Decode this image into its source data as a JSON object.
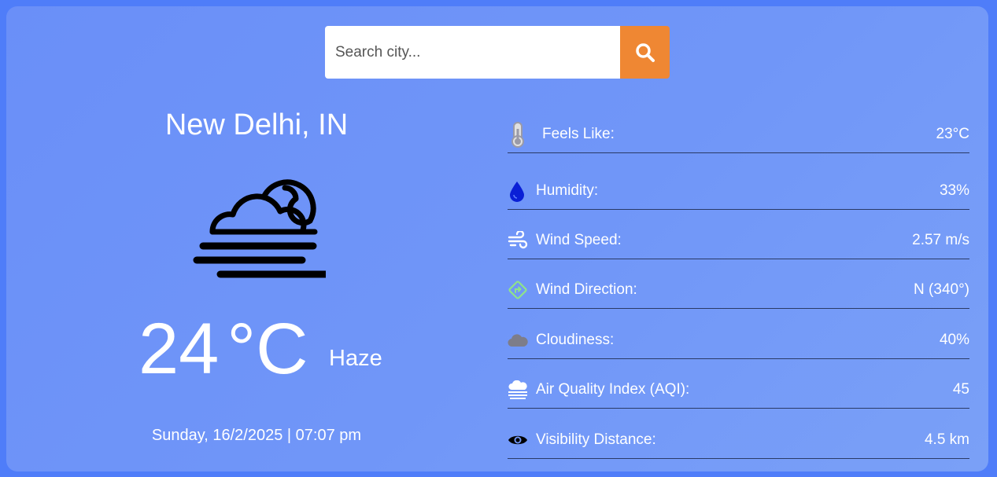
{
  "search": {
    "placeholder": "Search city...",
    "value": ""
  },
  "location": {
    "city": "New Delhi, IN"
  },
  "current": {
    "temperature": "24",
    "unit": "°C",
    "condition": "Haze",
    "datetime": "Sunday, 16/2/2025 | 07:07 pm",
    "icon": "haze-night-icon"
  },
  "details": [
    {
      "icon": "thermometer-icon",
      "label": "Feels Like:",
      "value": "23°C"
    },
    {
      "icon": "droplet-icon",
      "label": "Humidity:",
      "value": "33%"
    },
    {
      "icon": "wind-icon",
      "label": "Wind Speed:",
      "value": "2.57 m/s"
    },
    {
      "icon": "direction-sign-icon",
      "label": "Wind Direction:",
      "value": "N (340°)"
    },
    {
      "icon": "cloud-icon",
      "label": "Cloudiness:",
      "value": "40%"
    },
    {
      "icon": "smog-icon",
      "label": "Air Quality Index (AQI):",
      "value": "45"
    },
    {
      "icon": "eye-icon",
      "label": "Visibility Distance:",
      "value": "4.5 km"
    }
  ],
  "colors": {
    "background": "#4f7df9",
    "card": "#6a8ff8",
    "search_button": "#ef8733",
    "humidity_icon": "#0a1fd6",
    "direction_icon": "#8fe38a",
    "cloud_icon": "#7d7d8a"
  }
}
